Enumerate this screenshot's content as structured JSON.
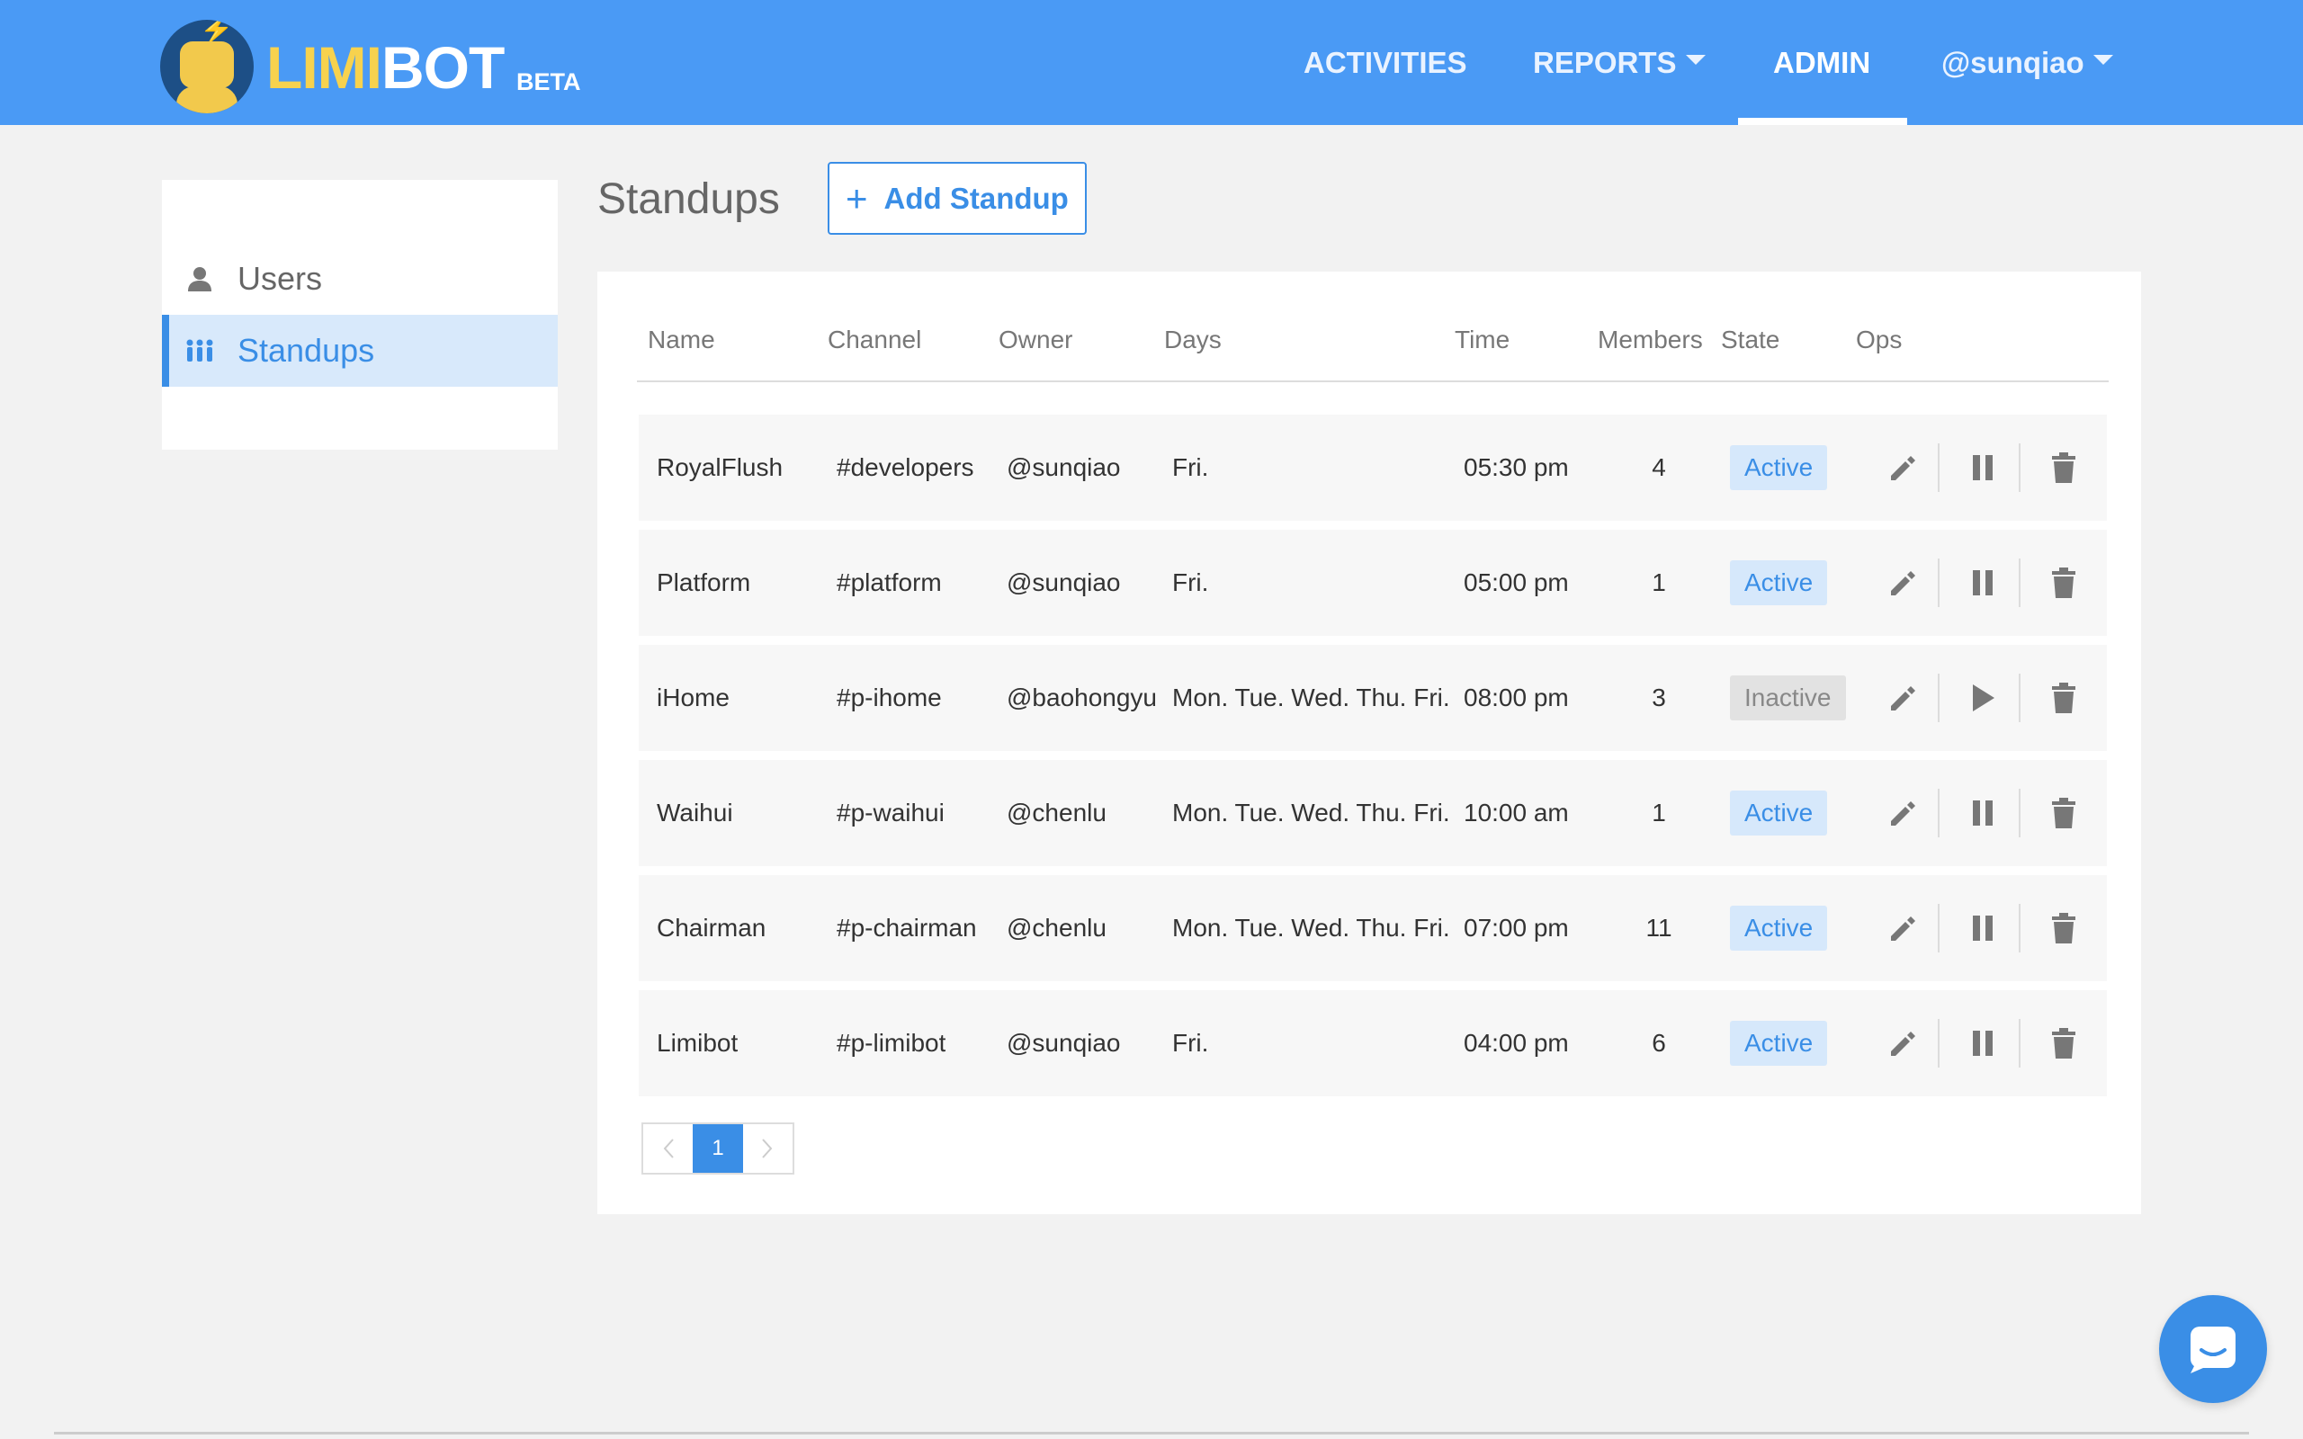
{
  "brand": {
    "name_part1": "LIMI",
    "name_part2": "BOT",
    "badge": "BETA",
    "logo_icon": "robot-face-icon"
  },
  "nav": {
    "activities": "ACTIVITIES",
    "reports": "REPORTS",
    "admin": "ADMIN",
    "user": "@sunqiao",
    "active_item": "ADMIN"
  },
  "sidebar": {
    "items": [
      {
        "label": "Users",
        "icon": "user-icon",
        "active": false
      },
      {
        "label": "Standups",
        "icon": "people-icon",
        "active": true
      }
    ]
  },
  "page": {
    "title": "Standups",
    "add_button": "Add Standup"
  },
  "table": {
    "columns": [
      "Name",
      "Channel",
      "Owner",
      "Days",
      "Time",
      "Members",
      "State",
      "Ops"
    ],
    "rows": [
      {
        "name": "RoyalFlush",
        "channel": "#developers",
        "owner": "@sunqiao",
        "days": "Fri.",
        "time": "05:30 pm",
        "members": "4",
        "state": "Active",
        "toggle": "pause"
      },
      {
        "name": "Platform",
        "channel": "#platform",
        "owner": "@sunqiao",
        "days": "Fri.",
        "time": "05:00 pm",
        "members": "1",
        "state": "Active",
        "toggle": "pause"
      },
      {
        "name": "iHome",
        "channel": "#p-ihome",
        "owner": "@baohongyu",
        "days": "Mon. Tue. Wed. Thu. Fri.",
        "time": "08:00 pm",
        "members": "3",
        "state": "Inactive",
        "toggle": "play"
      },
      {
        "name": "Waihui",
        "channel": "#p-waihui",
        "owner": "@chenlu",
        "days": "Mon. Tue. Wed. Thu. Fri.",
        "time": "10:00 am",
        "members": "1",
        "state": "Active",
        "toggle": "pause"
      },
      {
        "name": "Chairman",
        "channel": "#p-chairman",
        "owner": "@chenlu",
        "days": "Mon. Tue. Wed. Thu. Fri.",
        "time": "07:00 pm",
        "members": "11",
        "state": "Active",
        "toggle": "pause"
      },
      {
        "name": "Limibot",
        "channel": "#p-limibot",
        "owner": "@sunqiao",
        "days": "Fri.",
        "time": "04:00 pm",
        "members": "6",
        "state": "Active",
        "toggle": "pause"
      }
    ]
  },
  "pagination": {
    "current": "1",
    "prev_icon": "chevron-left-icon",
    "next_icon": "chevron-right-icon"
  },
  "chat": {
    "icon": "chat-bubble-icon"
  },
  "colors": {
    "primary": "#3a8ee6",
    "nav_bg": "#4a9af5",
    "brand_yellow": "#f7d24e",
    "inactive": "#888888"
  }
}
